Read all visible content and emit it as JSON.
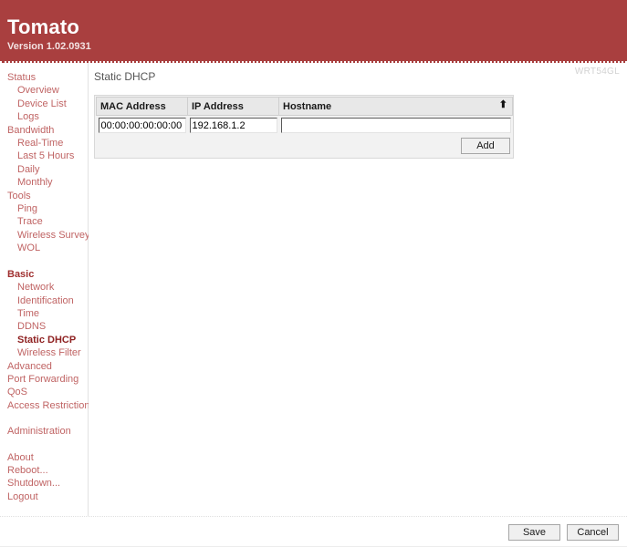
{
  "header": {
    "title": "Tomato",
    "version": "Version 1.02.0931"
  },
  "router_model": "WRT54GL",
  "sidebar": {
    "groups": [
      {
        "label": "Status",
        "state": "normal",
        "items": [
          {
            "label": "Overview",
            "state": "normal"
          },
          {
            "label": "Device List",
            "state": "normal"
          },
          {
            "label": "Logs",
            "state": "normal"
          }
        ]
      },
      {
        "label": "Bandwidth",
        "state": "normal",
        "items": [
          {
            "label": "Real-Time",
            "state": "normal"
          },
          {
            "label": "Last 5 Hours",
            "state": "normal"
          },
          {
            "label": "Daily",
            "state": "normal"
          },
          {
            "label": "Monthly",
            "state": "normal"
          }
        ]
      },
      {
        "label": "Tools",
        "state": "normal",
        "items": [
          {
            "label": "Ping",
            "state": "normal"
          },
          {
            "label": "Trace",
            "state": "normal"
          },
          {
            "label": "Wireless Survey",
            "state": "normal"
          },
          {
            "label": "WOL",
            "state": "normal"
          }
        ]
      },
      {
        "label": "Basic",
        "state": "section-active",
        "gap_before": true,
        "items": [
          {
            "label": "Network",
            "state": "normal"
          },
          {
            "label": "Identification",
            "state": "normal"
          },
          {
            "label": "Time",
            "state": "normal"
          },
          {
            "label": "DDNS",
            "state": "normal"
          },
          {
            "label": "Static DHCP",
            "state": "page-active"
          },
          {
            "label": "Wireless Filter",
            "state": "normal"
          }
        ]
      },
      {
        "label": "Advanced",
        "state": "normal",
        "items": []
      },
      {
        "label": "Port Forwarding",
        "state": "normal",
        "items": []
      },
      {
        "label": "QoS",
        "state": "normal",
        "items": []
      },
      {
        "label": "Access Restriction",
        "state": "normal",
        "items": []
      },
      {
        "label": "Administration",
        "state": "normal",
        "gap_before": true,
        "items": []
      },
      {
        "label": "About",
        "state": "normal",
        "gap_before": true,
        "items": []
      },
      {
        "label": "Reboot...",
        "state": "normal",
        "items": []
      },
      {
        "label": "Shutdown...",
        "state": "normal",
        "items": []
      },
      {
        "label": "Logout",
        "state": "normal",
        "items": []
      }
    ]
  },
  "main": {
    "page_title": "Static DHCP",
    "table": {
      "columns": [
        "MAC Address",
        "IP Address",
        "Hostname"
      ],
      "sort_column": "Hostname",
      "sort_arrow": "⬆",
      "new_row": {
        "mac_address": "00:00:00:00:00:00",
        "ip_address": "192.168.1.2",
        "hostname": ""
      }
    },
    "add_label": "Add"
  },
  "footer": {
    "save_label": "Save",
    "cancel_label": "Cancel"
  }
}
